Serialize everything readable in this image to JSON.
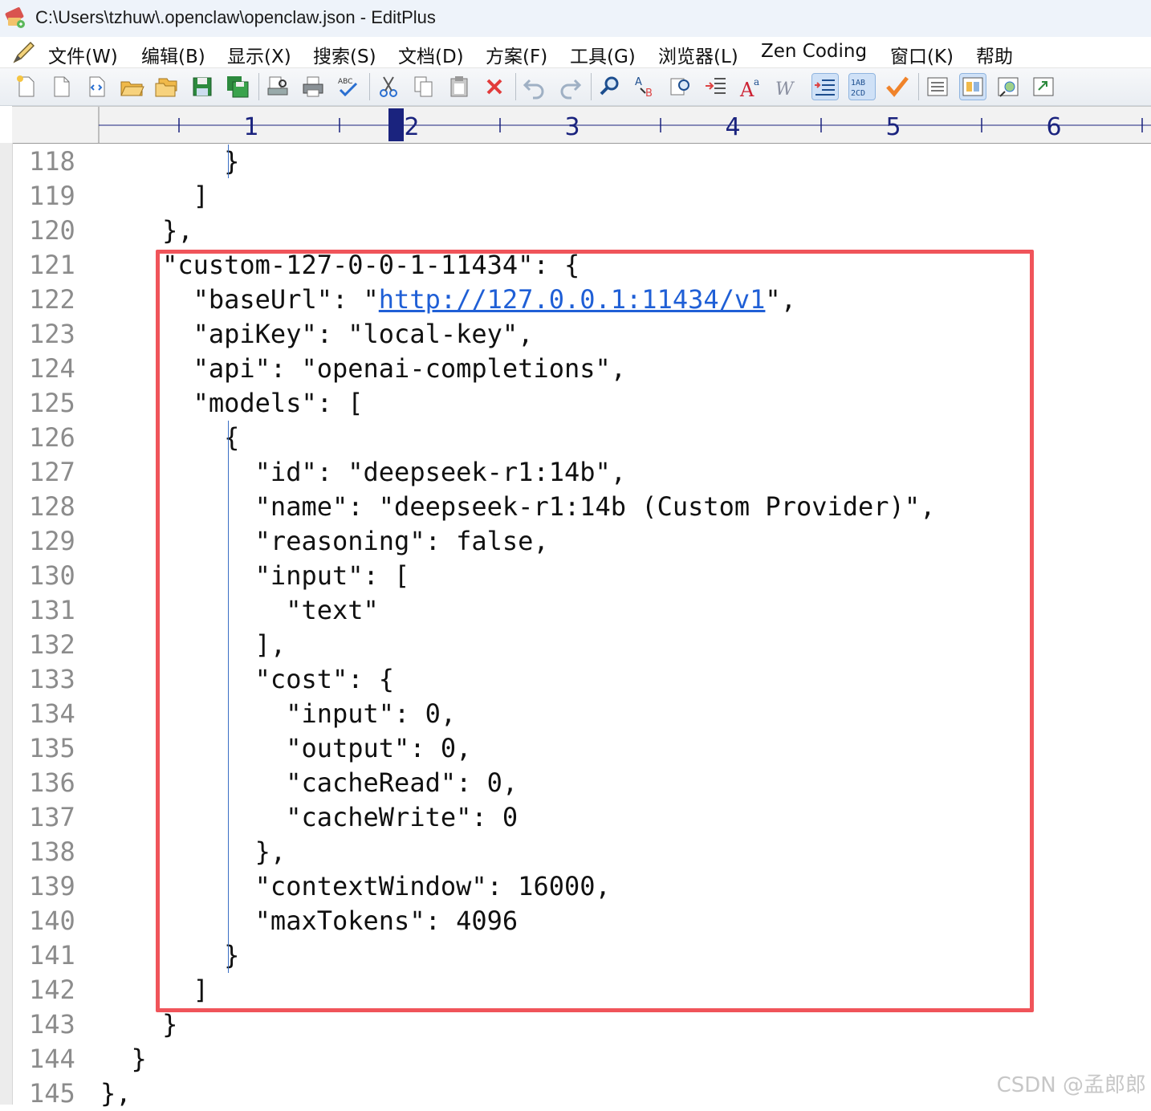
{
  "window": {
    "title": "C:\\Users\\tzhuw\\.openclaw\\openclaw.json - EditPlus",
    "app_icon": "editplus-icon"
  },
  "menu": {
    "items": [
      "文件(W)",
      "编辑(B)",
      "显示(X)",
      "搜索(S)",
      "文档(D)",
      "方案(F)",
      "工具(G)",
      "浏览器(L)",
      "Zen Coding",
      "窗口(K)",
      "帮助"
    ]
  },
  "toolbar": {
    "buttons": [
      "new-file-icon",
      "new-blank-icon",
      "new-html-icon",
      "open-folder-icon",
      "open-multiple-icon",
      "save-icon",
      "save-all-icon",
      "print-preview-icon",
      "print-icon",
      "spell-check-icon",
      "cut-icon",
      "copy-icon",
      "paste-icon",
      "delete-icon",
      "undo-icon",
      "redo-icon",
      "find-icon",
      "replace-icon",
      "find-in-files-icon",
      "indent-icon",
      "font-size-icon",
      "word-wrap-icon",
      "line-wrap-icon",
      "column-select-icon",
      "checkmark-icon",
      "directory-window-icon",
      "output-window-icon",
      "browser-preview-icon",
      "cliptext-icon"
    ]
  },
  "ruler": {
    "marks": [
      "1",
      "2",
      "3",
      "4",
      "5",
      "6"
    ]
  },
  "editor": {
    "lines": [
      {
        "number": "118",
        "text": "        }"
      },
      {
        "number": "119",
        "text": "      ]"
      },
      {
        "number": "120",
        "text": "    },"
      },
      {
        "number": "121",
        "text": "    \"custom-127-0-0-1-11434\": {"
      },
      {
        "number": "122",
        "text_pre": "      \"baseUrl\": \"",
        "link": "http://127.0.0.1:11434/v1",
        "text_post": "\","
      },
      {
        "number": "123",
        "text": "      \"apiKey\": \"local-key\","
      },
      {
        "number": "124",
        "text": "      \"api\": \"openai-completions\","
      },
      {
        "number": "125",
        "text": "      \"models\": ["
      },
      {
        "number": "126",
        "text": "        {"
      },
      {
        "number": "127",
        "text": "          \"id\": \"deepseek-r1:14b\","
      },
      {
        "number": "128",
        "text": "          \"name\": \"deepseek-r1:14b (Custom Provider)\","
      },
      {
        "number": "129",
        "text": "          \"reasoning\": false,"
      },
      {
        "number": "130",
        "text": "          \"input\": ["
      },
      {
        "number": "131",
        "text": "            \"text\""
      },
      {
        "number": "132",
        "text": "          ],"
      },
      {
        "number": "133",
        "text": "          \"cost\": {"
      },
      {
        "number": "134",
        "text": "            \"input\": 0,"
      },
      {
        "number": "135",
        "text": "            \"output\": 0,"
      },
      {
        "number": "136",
        "text": "            \"cacheRead\": 0,"
      },
      {
        "number": "137",
        "text": "            \"cacheWrite\": 0"
      },
      {
        "number": "138",
        "text": "          },"
      },
      {
        "number": "139",
        "text": "          \"contextWindow\": 16000,"
      },
      {
        "number": "140",
        "text": "          \"maxTokens\": 4096"
      },
      {
        "number": "141",
        "text": "        }"
      },
      {
        "number": "142",
        "text": "      ]"
      },
      {
        "number": "143",
        "text": "    }"
      },
      {
        "number": "144",
        "text": "  }"
      },
      {
        "number": "145",
        "text": "},"
      }
    ]
  },
  "annotation": {
    "highlight_color": "#f0545a"
  },
  "watermark": "CSDN @孟郎郎"
}
